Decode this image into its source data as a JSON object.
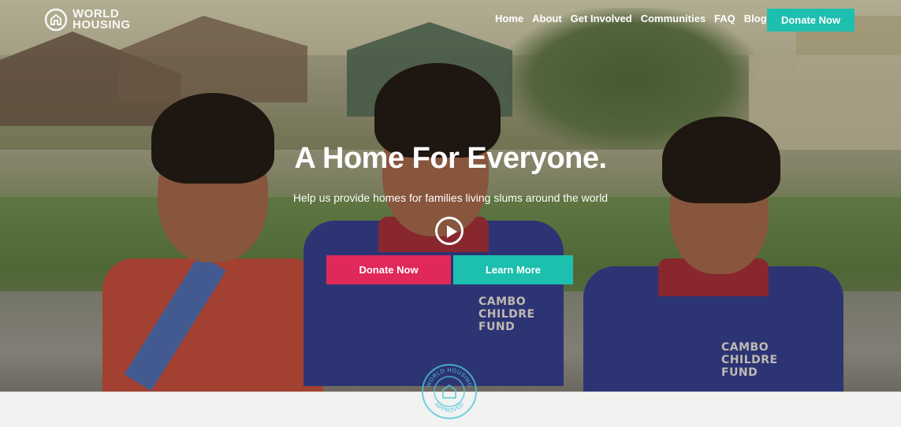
{
  "brand": {
    "line1": "WORLD",
    "line2": "HOUSING",
    "icon": "house-outline-icon"
  },
  "nav": {
    "items": [
      "Home",
      "About",
      "Get Involved",
      "Communities",
      "FAQ",
      "Blog"
    ],
    "donate_label": "Donate Now"
  },
  "hero": {
    "headline": "A Home For Everyone.",
    "subhead": "Help us provide homes for families living slums around the world",
    "play_icon": "play-circle-icon",
    "primary_label": "Donate Now",
    "secondary_label": "Learn More"
  },
  "shirts": {
    "kid_mid": "CAMBO\nCHILDRE\nFUND",
    "kid_right": "CAMBO\nCHILDRE\nFUND"
  },
  "seal": {
    "top_text": "WORLD HOUSING",
    "bottom_text": "APPROVED"
  },
  "colors": {
    "teal": "#1dbfae",
    "pink": "#e0285a",
    "strip": "#f2f2f1"
  }
}
